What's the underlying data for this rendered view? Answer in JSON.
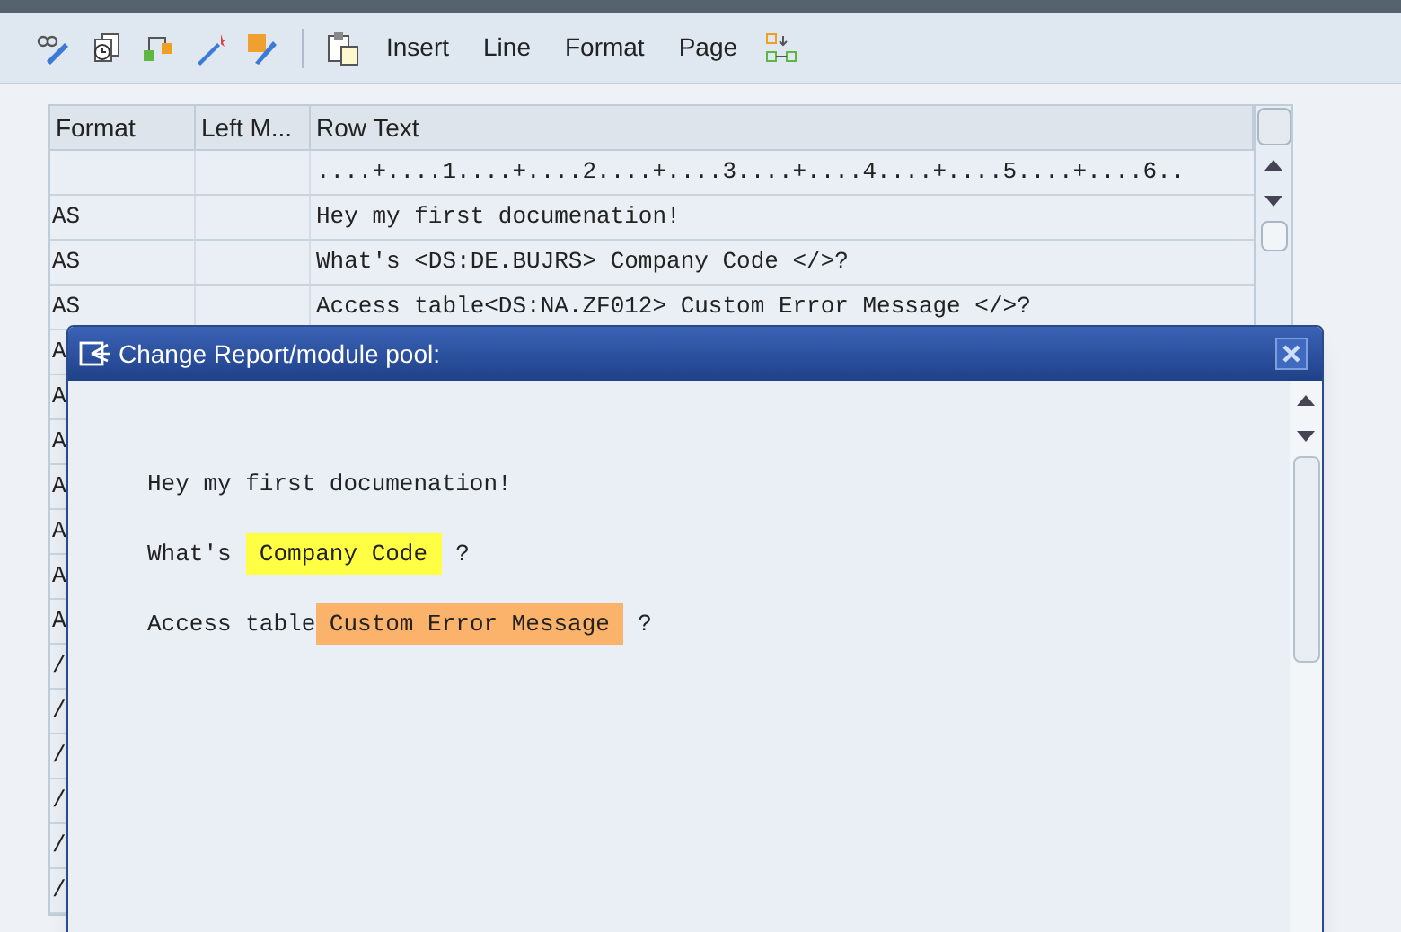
{
  "toolbar": {
    "buttons": [
      "Insert",
      "Line",
      "Format",
      "Page"
    ]
  },
  "table": {
    "columns": [
      "Format",
      "Left M...",
      "Row Text"
    ],
    "ruler": "....+....1....+....2....+....3....+....4....+....5....+....6..",
    "rows": [
      {
        "format": "AS",
        "text": "Hey my first documenation!"
      },
      {
        "format": "AS",
        "text": "What's <DS:DE.BUJRS> Company Code </>?"
      },
      {
        "format": "AS",
        "text": "Access table<DS:NA.ZF012> Custom Error Message </>?"
      },
      {
        "format": "A"
      },
      {
        "format": "A"
      },
      {
        "format": "A"
      },
      {
        "format": "A"
      },
      {
        "format": "A"
      },
      {
        "format": "A"
      },
      {
        "format": "A"
      },
      {
        "format": "/"
      },
      {
        "format": "/"
      },
      {
        "format": "/"
      },
      {
        "format": "/"
      },
      {
        "format": "/"
      },
      {
        "format": "/"
      }
    ]
  },
  "dialog": {
    "title": "Change Report/module pool:",
    "lines": [
      {
        "parts": [
          {
            "text": "Hey my first documenation!"
          }
        ]
      },
      {
        "parts": [
          {
            "text": "What's "
          },
          {
            "text": " Company Code ",
            "color": "#ffff44"
          },
          {
            "text": " ?"
          }
        ]
      },
      {
        "parts": [
          {
            "text": "Access table"
          },
          {
            "text": " Custom Error Message ",
            "color": "#fbb36b"
          },
          {
            "text": " ?"
          }
        ]
      }
    ]
  }
}
